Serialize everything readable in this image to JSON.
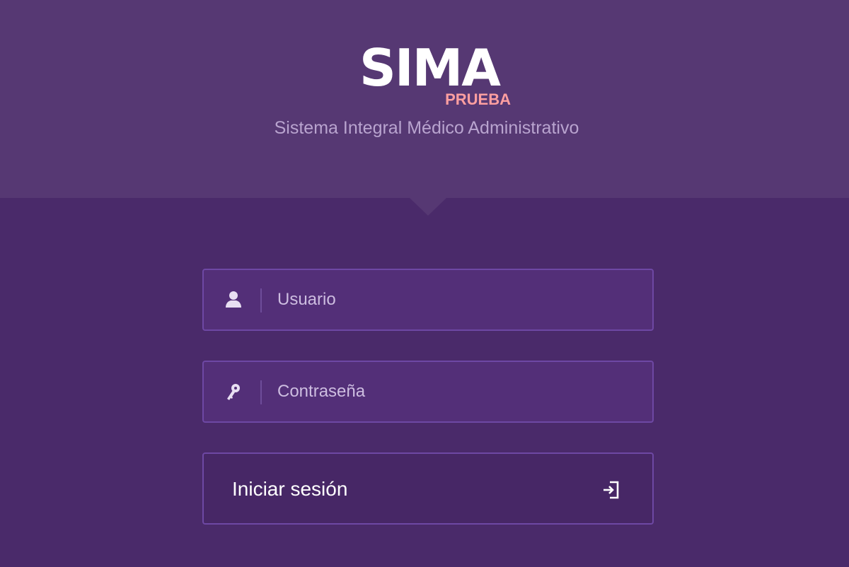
{
  "brand": {
    "name": "SIMA",
    "environment": "PRUEBA",
    "tagline": "Sistema Integral Médico Administrativo"
  },
  "login_form": {
    "username": {
      "placeholder": "Usuario",
      "value": "",
      "icon": "user-icon"
    },
    "password": {
      "placeholder": "Contraseña",
      "value": "",
      "icon": "key-icon"
    },
    "submit": {
      "label": "Iniciar sesión",
      "icon": "login-icon"
    }
  },
  "colors": {
    "header_bg": "#563873",
    "page_bg": "#4a2a6a",
    "field_bg": "#532f78",
    "field_border": "#6e48a4",
    "environment_badge": "#ff9fa0",
    "tagline": "#b9a4cf"
  }
}
